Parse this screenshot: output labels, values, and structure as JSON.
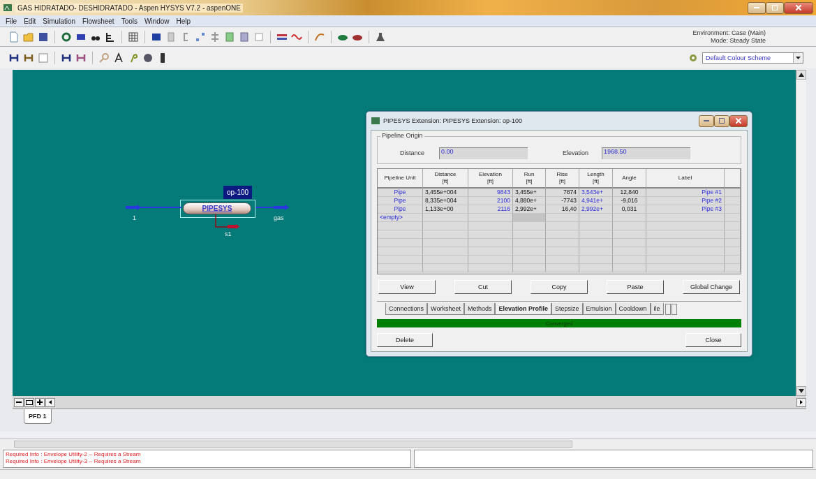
{
  "window": {
    "title": "GAS HIDRATADO- DESHIDRATADO - Aspen HYSYS V7.2 - aspenONE"
  },
  "menu": [
    "File",
    "Edit",
    "Simulation",
    "Flowsheet",
    "Tools",
    "Window",
    "Help"
  ],
  "environment": {
    "environment": "Environment: Case (Main)",
    "mode": "Mode: Steady State"
  },
  "colour_scheme": {
    "value": "Default Colour Scheme"
  },
  "flowsheet": {
    "unit": {
      "name": "op-100",
      "label": "PIPESYS",
      "selected": true
    },
    "streams": [
      {
        "name": "1",
        "kind": "feed"
      },
      {
        "name": "gas",
        "kind": "product"
      },
      {
        "name": "s1",
        "kind": "energy"
      }
    ]
  },
  "pfd_tabs": [
    {
      "label": "PFD 1",
      "selected": true
    }
  ],
  "dialog": {
    "title": "PIPESYS Extension: PIPESYS Extension: op-100",
    "origin": {
      "title": "Pipeline Origin",
      "fields": [
        {
          "label": "Distance",
          "value": "0.00"
        },
        {
          "label": "Elevation",
          "value": "1968.50"
        }
      ]
    },
    "columns": [
      {
        "label": "Pipeline Unit"
      },
      {
        "label": "Distance",
        "unit": "[ft]"
      },
      {
        "label": "Elevation",
        "unit": "[ft]"
      },
      {
        "label": "Run",
        "unit": "[ft]"
      },
      {
        "label": "Rise",
        "unit": "[ft]"
      },
      {
        "label": "Length",
        "unit": "[ft]"
      },
      {
        "label": "Angle"
      },
      {
        "label": "Label"
      }
    ],
    "rows": [
      {
        "cells": [
          {
            "text": "Pipe",
            "specified": true
          },
          {
            "text": "3,455e+004",
            "specified": false
          },
          {
            "text": "9843",
            "specified": true
          },
          {
            "text": "3,455e+",
            "specified": false
          },
          {
            "text": "7874",
            "specified": false
          },
          {
            "text": "3,543e+",
            "specified": true
          },
          {
            "text": "12,840",
            "specified": false
          },
          {
            "text": "Pipe #1",
            "specified": true
          }
        ]
      },
      {
        "cells": [
          {
            "text": "Pipe",
            "specified": true
          },
          {
            "text": "8,335e+004",
            "specified": false
          },
          {
            "text": "2100",
            "specified": true
          },
          {
            "text": "4,880e+",
            "specified": false
          },
          {
            "text": "-7743",
            "specified": false
          },
          {
            "text": "4,941e+",
            "specified": true
          },
          {
            "text": "-9,016",
            "specified": false
          },
          {
            "text": "Pipe #2",
            "specified": true
          }
        ]
      },
      {
        "cells": [
          {
            "text": "Pipe",
            "specified": true
          },
          {
            "text": "1,133e+00",
            "specified": false
          },
          {
            "text": "2116",
            "specified": true
          },
          {
            "text": "2,992e+",
            "specified": false
          },
          {
            "text": "16,40",
            "specified": false
          },
          {
            "text": "2,992e+",
            "specified": true
          },
          {
            "text": "0,031",
            "specified": false
          },
          {
            "text": "Pipe #3",
            "specified": true
          }
        ]
      }
    ],
    "empty_row": "<empty>",
    "buttons": [
      "View",
      "Cut",
      "Copy",
      "Paste",
      "Global Change"
    ],
    "tabs": [
      {
        "label": "Connections",
        "selected": false
      },
      {
        "label": "Worksheet",
        "selected": false
      },
      {
        "label": "Methods",
        "selected": false
      },
      {
        "label": "Elevation Profile",
        "selected": true
      },
      {
        "label": "Stepsize",
        "selected": false
      },
      {
        "label": "Emulsion",
        "selected": false
      },
      {
        "label": "Cooldown",
        "selected": false
      },
      {
        "label": "ile",
        "selected": false
      }
    ],
    "status": {
      "text": "Converged",
      "kind": "converged"
    },
    "footer_buttons": [
      "Delete",
      "Close"
    ]
  },
  "messages": [
    "Required Info : Envelope Utility-2 -- Requires a Stream",
    "Required Info : Envelope Utility-3 -- Requires a Stream"
  ]
}
